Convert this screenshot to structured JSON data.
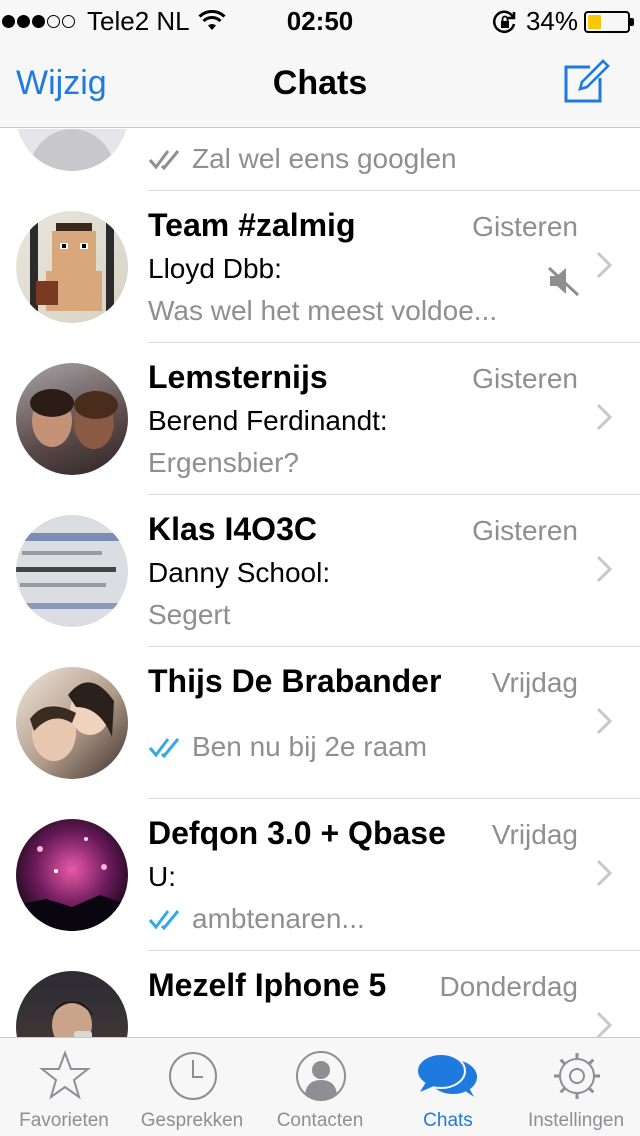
{
  "status_bar": {
    "carrier": "Tele2 NL",
    "time": "02:50",
    "battery": "34%",
    "battery_level": 0.34
  },
  "nav": {
    "edit_label": "Wijzig",
    "title": "Chats"
  },
  "colors": {
    "accent": "#1f7ae0",
    "secondary_text": "#8e8e93",
    "battery": "#f4c90b"
  },
  "chats": [
    {
      "name": "",
      "time": "",
      "sender": "",
      "preview": "Zal wel eens googlen"
    },
    {
      "name": "Team #zalmig",
      "time": "Gisteren",
      "sender": "Lloyd Dbb:",
      "preview": "Was wel het meest voldoe..."
    },
    {
      "name": "Lemsternijs",
      "time": "Gisteren",
      "sender": "Berend Ferdinandt:",
      "preview": "Ergensbier?"
    },
    {
      "name": "Klas I4O3C",
      "time": "Gisteren",
      "sender": "Danny School:",
      "preview": "Segert"
    },
    {
      "name": "Thijs De Brabander",
      "time": "Vrijdag",
      "sender": "",
      "preview": "Ben nu bij 2e raam"
    },
    {
      "name": "Defqon 3.0 + Qbase",
      "time": "Vrijdag",
      "sender": "U:",
      "preview": "ambtenaren..."
    },
    {
      "name": "Mezelf Iphone 5",
      "time": "Donderdag",
      "sender": "",
      "preview": ""
    }
  ],
  "tabs": [
    {
      "label": "Favorieten",
      "icon": "star-icon"
    },
    {
      "label": "Gesprekken",
      "icon": "clock-icon"
    },
    {
      "label": "Contacten",
      "icon": "contact-icon"
    },
    {
      "label": "Chats",
      "icon": "chats-icon"
    },
    {
      "label": "Instellingen",
      "icon": "gear-icon"
    }
  ]
}
